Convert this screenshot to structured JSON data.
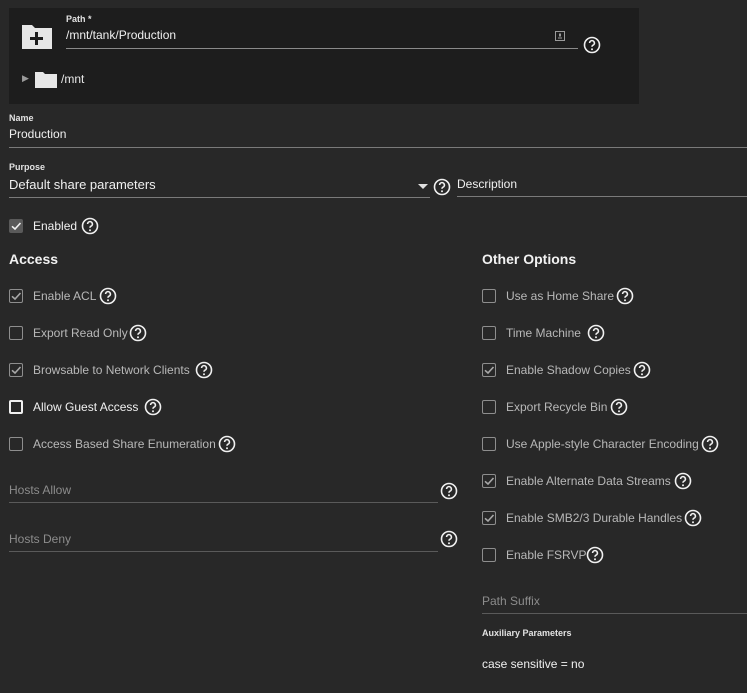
{
  "path": {
    "label": "Path *",
    "value": "/mnt/tank/Production",
    "tree_root": "/mnt"
  },
  "name": {
    "label": "Name",
    "value": "Production"
  },
  "purpose": {
    "label": "Purpose",
    "value": "Default share parameters"
  },
  "description": {
    "placeholder": "Description"
  },
  "enabled": {
    "label": "Enabled",
    "checked": true
  },
  "access": {
    "title": "Access",
    "options": [
      {
        "label": "Enable ACL",
        "checked": true
      },
      {
        "label": "Export Read Only",
        "checked": false
      },
      {
        "label": "Browsable to Network Clients",
        "checked": true
      },
      {
        "label": "Allow Guest Access",
        "checked": false
      },
      {
        "label": "Access Based Share Enumeration",
        "checked": false
      }
    ],
    "hosts_allow": "Hosts Allow",
    "hosts_deny": "Hosts Deny"
  },
  "other": {
    "title": "Other Options",
    "options": [
      {
        "label": "Use as Home Share",
        "checked": false
      },
      {
        "label": "Time Machine",
        "checked": false
      },
      {
        "label": "Enable Shadow Copies",
        "checked": true
      },
      {
        "label": "Export Recycle Bin",
        "checked": false
      },
      {
        "label": "Use Apple-style Character Encoding",
        "checked": false
      },
      {
        "label": "Enable Alternate Data Streams",
        "checked": true
      },
      {
        "label": "Enable SMB2/3 Durable Handles",
        "checked": true
      },
      {
        "label": "Enable FSRVP",
        "checked": false
      }
    ],
    "path_suffix": "Path Suffix",
    "aux_label": "Auxiliary Parameters",
    "aux_value": "case sensitive = no"
  }
}
